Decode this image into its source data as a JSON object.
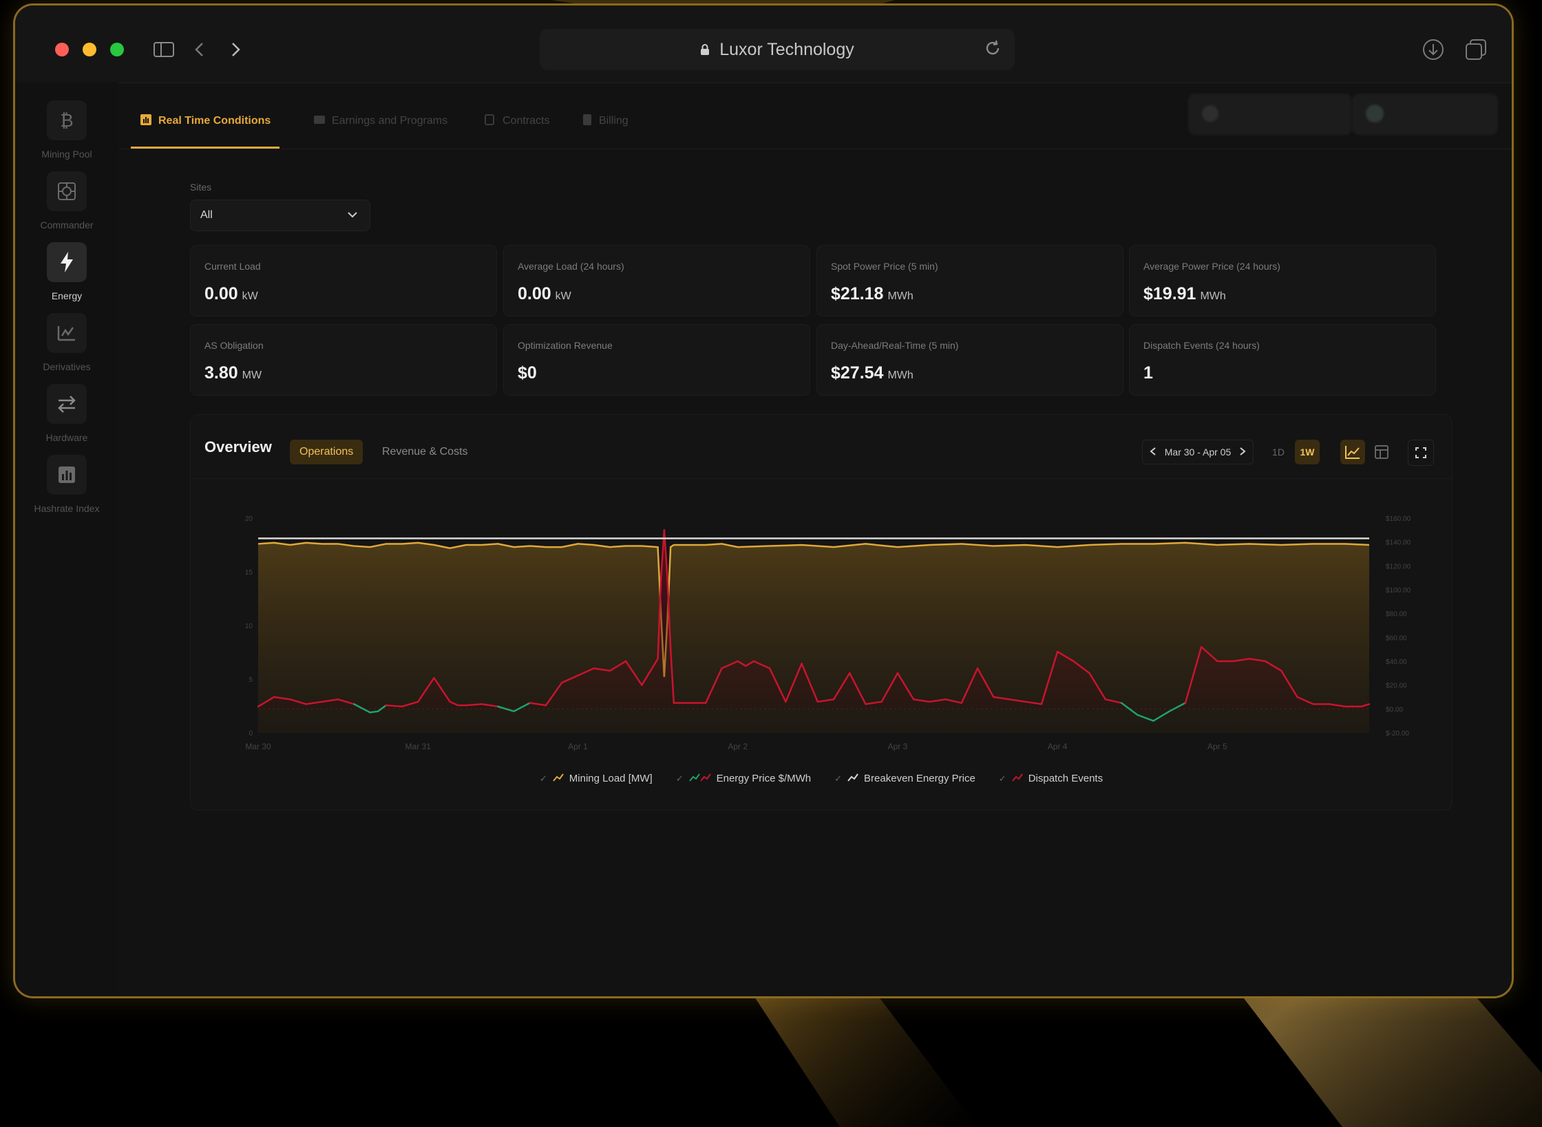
{
  "browser": {
    "url_title": "Luxor Technology"
  },
  "sidebar": {
    "items": [
      {
        "label": "Mining Pool",
        "icon": "bitcoin-icon"
      },
      {
        "label": "Commander",
        "icon": "chip-icon"
      },
      {
        "label": "Energy",
        "icon": "bolt-icon",
        "active": true
      },
      {
        "label": "Derivatives",
        "icon": "derivatives-chart-icon"
      },
      {
        "label": "Hardware",
        "icon": "swap-arrows-icon"
      },
      {
        "label": "Hashrate Index",
        "icon": "bar-chart-icon"
      }
    ]
  },
  "tabs": [
    {
      "label": "Real Time Conditions",
      "active": true
    },
    {
      "label": "Earnings and Programs"
    },
    {
      "label": "Contracts"
    },
    {
      "label": "Billing"
    }
  ],
  "filters": {
    "sites_label": "Sites",
    "sites_value": "All"
  },
  "cards": [
    {
      "label": "Current Load",
      "value": "0.00",
      "unit": "kW"
    },
    {
      "label": "Average Load (24 hours)",
      "value": "0.00",
      "unit": "kW"
    },
    {
      "label": "Spot Power Price (5 min)",
      "value": "$21.18",
      "unit": "MWh"
    },
    {
      "label": "Average Power Price (24 hours)",
      "value": "$19.91",
      "unit": "MWh"
    },
    {
      "label": "AS Obligation",
      "value": "3.80",
      "unit": "MW"
    },
    {
      "label": "Optimization Revenue",
      "value": "$0",
      "unit": ""
    },
    {
      "label": "Day-Ahead/Real-Time (5 min)",
      "value": "$27.54",
      "unit": "MWh"
    },
    {
      "label": "Dispatch Events (24 hours)",
      "value": "1",
      "unit": ""
    }
  ],
  "overview": {
    "title": "Overview",
    "segments": [
      "Operations",
      "Revenue & Costs"
    ],
    "range": "Mar 30 - Apr 05",
    "period_buttons": [
      "1D",
      "1W"
    ]
  },
  "colors": {
    "accent": "#e7a93a",
    "mining_load": "#e0a83a",
    "energy_price": "#c8142e",
    "energy_price_negative": "#1fa36a",
    "breakeven": "#d8d8d8"
  },
  "chart_data": {
    "type": "line",
    "x_ticks": [
      "Mar 30",
      "Mar 31",
      "Apr 1",
      "Apr 2",
      "Apr 3",
      "Apr 4",
      "Apr 5"
    ],
    "y_left_ticks": [
      "0",
      "5",
      "10",
      "15",
      "20"
    ],
    "y_right_ticks": [
      "$-20.00",
      "$0.00",
      "$20.00",
      "$40.00",
      "$60.00",
      "$80.00",
      "$100.00",
      "$120.00",
      "$140.00",
      "$160.00"
    ],
    "y_left_range": [
      0,
      20
    ],
    "y_right_range": [
      -20,
      160
    ],
    "series": [
      {
        "name": "Mining Load [MW]",
        "type": "area",
        "x": [
          0,
          0.1,
          0.2,
          0.3,
          0.4,
          0.5,
          0.6,
          0.7,
          0.8,
          0.9,
          1.0,
          1.1,
          1.2,
          1.3,
          1.4,
          1.5,
          1.6,
          1.7,
          1.8,
          1.9,
          2.0,
          2.1,
          2.2,
          2.3,
          2.4,
          2.5,
          2.52,
          2.54,
          2.56,
          2.58,
          2.6,
          2.7,
          2.8,
          2.9,
          3.0,
          3.2,
          3.4,
          3.6,
          3.8,
          4.0,
          4.2,
          4.4,
          4.6,
          4.8,
          5.0,
          5.2,
          5.4,
          5.6,
          5.8,
          6.0,
          6.2,
          6.4,
          6.6,
          6.8,
          6.95
        ],
        "y": [
          17.6,
          17.7,
          17.5,
          17.7,
          17.6,
          17.6,
          17.4,
          17.3,
          17.6,
          17.6,
          17.7,
          17.5,
          17.2,
          17.5,
          17.5,
          17.6,
          17.3,
          17.4,
          17.3,
          17.3,
          17.6,
          17.5,
          17.3,
          17.4,
          17.4,
          17.3,
          11.0,
          5.2,
          10.5,
          17.3,
          17.5,
          17.5,
          17.5,
          17.6,
          17.3,
          17.4,
          17.5,
          17.3,
          17.6,
          17.3,
          17.5,
          17.6,
          17.4,
          17.5,
          17.3,
          17.5,
          17.6,
          17.6,
          17.7,
          17.5,
          17.6,
          17.5,
          17.6,
          17.6,
          17.5
        ]
      },
      {
        "name": "Energy Price $/MWh",
        "type": "area",
        "x": [
          0,
          0.1,
          0.2,
          0.3,
          0.4,
          0.5,
          0.6,
          0.7,
          0.75,
          0.8,
          0.9,
          1.0,
          1.1,
          1.2,
          1.25,
          1.3,
          1.4,
          1.5,
          1.6,
          1.7,
          1.8,
          1.9,
          2.0,
          2.1,
          2.2,
          2.3,
          2.4,
          2.5,
          2.52,
          2.54,
          2.56,
          2.58,
          2.6,
          2.7,
          2.8,
          2.9,
          3.0,
          3.05,
          3.1,
          3.2,
          3.3,
          3.4,
          3.5,
          3.6,
          3.7,
          3.8,
          3.9,
          4.0,
          4.1,
          4.2,
          4.3,
          4.4,
          4.5,
          4.6,
          4.7,
          4.8,
          4.9,
          5.0,
          5.1,
          5.2,
          5.3,
          5.4,
          5.5,
          5.6,
          5.7,
          5.8,
          5.9,
          6.0,
          6.1,
          6.2,
          6.3,
          6.4,
          6.5,
          6.6,
          6.7,
          6.8,
          6.9,
          6.95
        ],
        "y": [
          2,
          10,
          8,
          4,
          6,
          8,
          4,
          -3,
          -2,
          3,
          2,
          6,
          26,
          6,
          3,
          3,
          4,
          2,
          -2,
          5,
          3,
          22,
          28,
          34,
          32,
          40,
          20,
          42,
          110,
          150,
          110,
          50,
          5,
          5,
          5,
          34,
          40,
          36,
          40,
          34,
          6,
          38,
          6,
          8,
          30,
          4,
          6,
          30,
          8,
          6,
          8,
          5,
          34,
          10,
          8,
          6,
          4,
          48,
          40,
          30,
          8,
          5,
          -5,
          -10,
          -2,
          5,
          52,
          40,
          40,
          42,
          40,
          32,
          10,
          4,
          4,
          2,
          2,
          4
        ]
      },
      {
        "name": "Breakeven Energy Price",
        "type": "line",
        "x": [
          0,
          6.95
        ],
        "y": [
          143,
          143
        ]
      },
      {
        "name": "Dispatch Events",
        "type": "marker",
        "x": [],
        "y": []
      }
    ]
  }
}
